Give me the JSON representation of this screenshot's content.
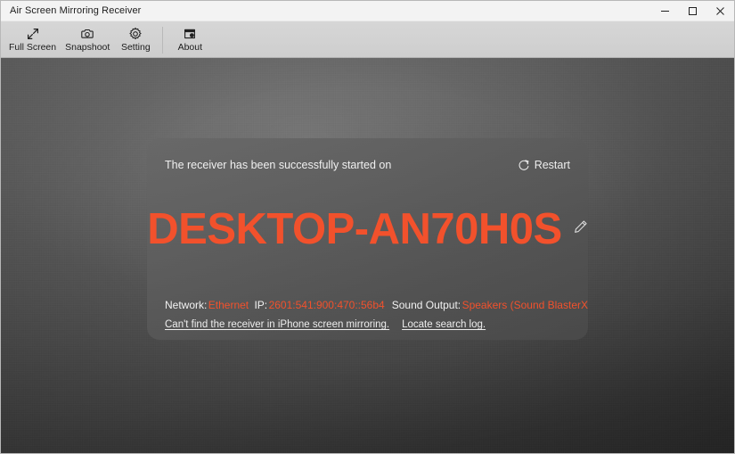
{
  "window": {
    "title": "Air Screen Mirroring Receiver",
    "controls": [
      {
        "name": "minimize",
        "glyph": "minimize-icon"
      },
      {
        "name": "maximize",
        "glyph": "maximize-icon"
      },
      {
        "name": "close",
        "glyph": "close-icon"
      }
    ]
  },
  "toolbar": {
    "items": [
      {
        "label": "Full Screen",
        "icon": "fullscreen-arrow-icon"
      },
      {
        "label": "Snapshoot",
        "icon": "camera-icon"
      },
      {
        "label": "Setting",
        "icon": "gear-icon"
      },
      {
        "label": "About",
        "icon": "info-window-icon"
      }
    ]
  },
  "card": {
    "status_text": "The receiver has been successfully started on",
    "restart_label": "Restart",
    "restart_icon": "refresh-circle-icon",
    "device_name": "DESKTOP-AN70H0S",
    "edit_icon": "pencil-icon",
    "info": {
      "network_label": "Network:",
      "network_value": "Ethernet",
      "ip_label": "IP:",
      "ip_value": "2601:541:900:470::56b4",
      "sound_label": "Sound Output:",
      "sound_value": "Speakers (Sound BlasterX"
    },
    "links": [
      {
        "label": "Can't find the receiver in iPhone screen mirroring."
      },
      {
        "label": "Locate search log."
      }
    ]
  },
  "colors": {
    "accent_orange": "#f2512c",
    "card_text": "#f0f0f0",
    "toolbar_bg": "#d2d2d2",
    "titlebar_bg": "#f3f3f3"
  }
}
